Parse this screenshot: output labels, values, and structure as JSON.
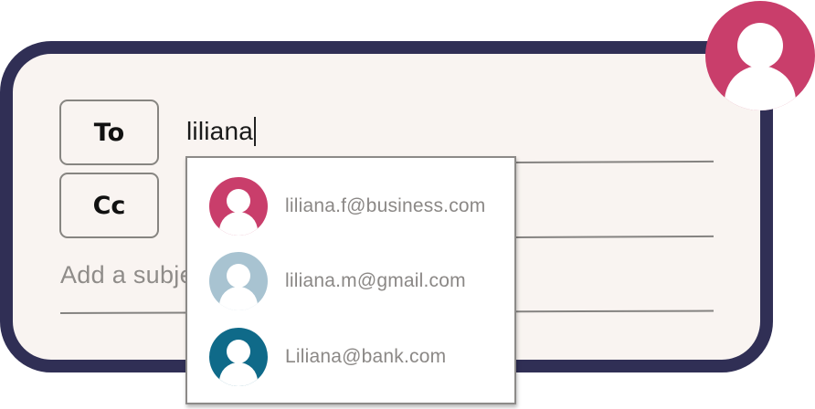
{
  "compose": {
    "to_label": "To",
    "cc_label": "Cc",
    "to_value": "liliana",
    "subject_placeholder": "Add a subject"
  },
  "autocomplete": {
    "suggestions": [
      {
        "email": "liliana.f@business.com",
        "avatar_color": "#c93e6b",
        "icon": "person-icon"
      },
      {
        "email": "liliana.m@gmail.com",
        "avatar_color": "#a8c3d1",
        "icon": "person-icon"
      },
      {
        "email": "Liliana@bank.com",
        "avatar_color": "#0f6a89",
        "icon": "person-icon"
      }
    ]
  },
  "user": {
    "avatar_color": "#c93e6b",
    "icon": "person-icon"
  },
  "colors": {
    "card_border": "#302f55",
    "card_background": "#f9f4f1"
  }
}
